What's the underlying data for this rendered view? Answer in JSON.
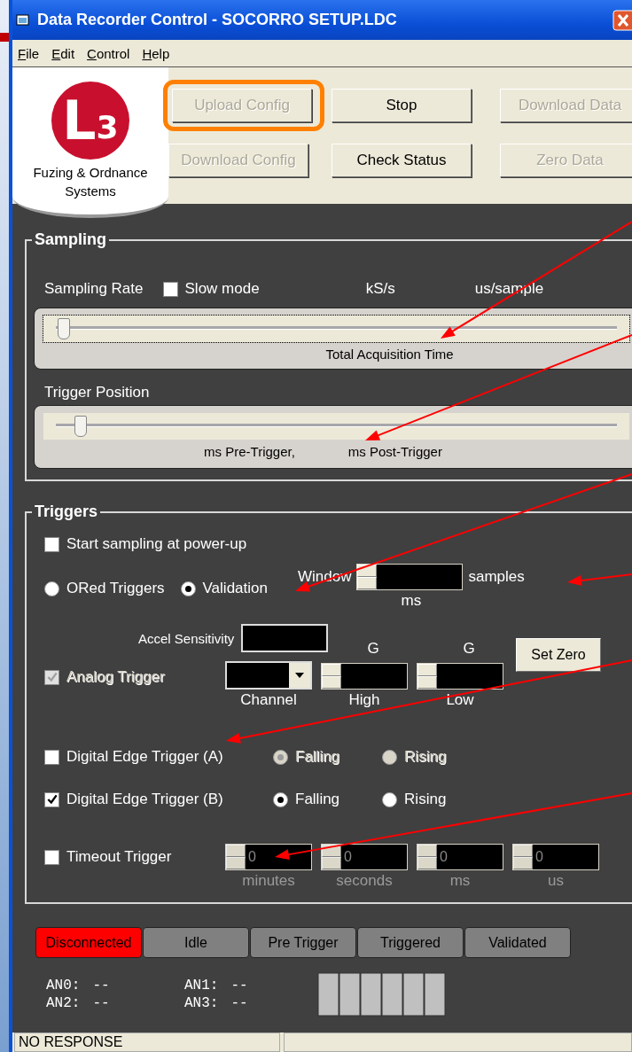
{
  "window": {
    "title": "Data Recorder Control - SOCORRO SETUP.LDC"
  },
  "menu": [
    "File",
    "Edit",
    "Control",
    "Help"
  ],
  "logo": {
    "letter": "L",
    "digit": "3",
    "caption": "Fuzing & Ordnance Systems"
  },
  "buttons": [
    {
      "label": "Upload Config",
      "disabled": true,
      "highlighted": true
    },
    {
      "label": "Stop",
      "disabled": false,
      "highlighted": false
    },
    {
      "label": "Download Data",
      "disabled": true,
      "highlighted": false
    },
    {
      "label": "Download Config",
      "disabled": true,
      "highlighted": false
    },
    {
      "label": "Check Status",
      "disabled": false,
      "highlighted": false
    },
    {
      "label": "Zero Data",
      "disabled": true,
      "highlighted": false
    }
  ],
  "sampling": {
    "title": "Sampling",
    "rate_label": "Sampling Rate",
    "slow_mode": {
      "label": "Slow mode",
      "checked": false
    },
    "rate_unit": "kS/s",
    "period_unit": "us/sample",
    "rate_slider": {
      "level": 0.01,
      "caption": "Total Acquisition Time"
    },
    "trigger_label": "Trigger Position",
    "trigger_slider": {
      "level": 0.04,
      "pre_caption": "ms Pre-Trigger,",
      "post_caption": "ms Post-Trigger"
    }
  },
  "triggers": {
    "title": "Triggers",
    "power_up": {
      "label": "Start sampling at power-up",
      "checked": false
    },
    "modes": [
      {
        "label": "ORed Triggers",
        "selected": false
      },
      {
        "label": "Validation",
        "selected": true
      }
    ],
    "window": {
      "label": "Window",
      "unit": "samples",
      "sub_unit": "ms"
    },
    "accel_label": "Accel Sensitivity",
    "analog": {
      "label": "Analog Trigger",
      "checked": true,
      "disabled": true,
      "channel_label": "Channel",
      "high_unit": "G",
      "high_label": "High",
      "low_unit": "G",
      "low_label": "Low",
      "zero_button": "Set Zero"
    },
    "digital": [
      {
        "label": "Digital Edge Trigger (A)",
        "checked": false,
        "disabled": true,
        "edges": [
          {
            "label": "Falling",
            "selected": true
          },
          {
            "label": "Rising",
            "selected": false
          }
        ]
      },
      {
        "label": "Digital Edge Trigger (B)",
        "checked": true,
        "disabled": false,
        "edges": [
          {
            "label": "Falling",
            "selected": true
          },
          {
            "label": "Rising",
            "selected": false
          }
        ]
      }
    ],
    "timeout": {
      "label": "Timeout Trigger",
      "checked": false,
      "fields": [
        {
          "value": "0",
          "unit": "minutes"
        },
        {
          "value": "0",
          "unit": "seconds"
        },
        {
          "value": "0",
          "unit": "ms"
        },
        {
          "value": "0",
          "unit": "us"
        }
      ]
    }
  },
  "indicators": [
    {
      "label": "Disconnected",
      "color": "#ff0000"
    },
    {
      "label": "Idle",
      "color": "#808080"
    },
    {
      "label": "Pre Trigger",
      "color": "#808080"
    },
    {
      "label": "Triggered",
      "color": "#808080"
    },
    {
      "label": "Validated",
      "color": "#808080"
    }
  ],
  "readouts": [
    {
      "label": "AN0:",
      "value": "--"
    },
    {
      "label": "AN1:",
      "value": "--"
    },
    {
      "label": "AN2:",
      "value": "--"
    },
    {
      "label": "AN3:",
      "value": "--"
    }
  ],
  "status_bar": [
    "NO RESPONSE"
  ]
}
